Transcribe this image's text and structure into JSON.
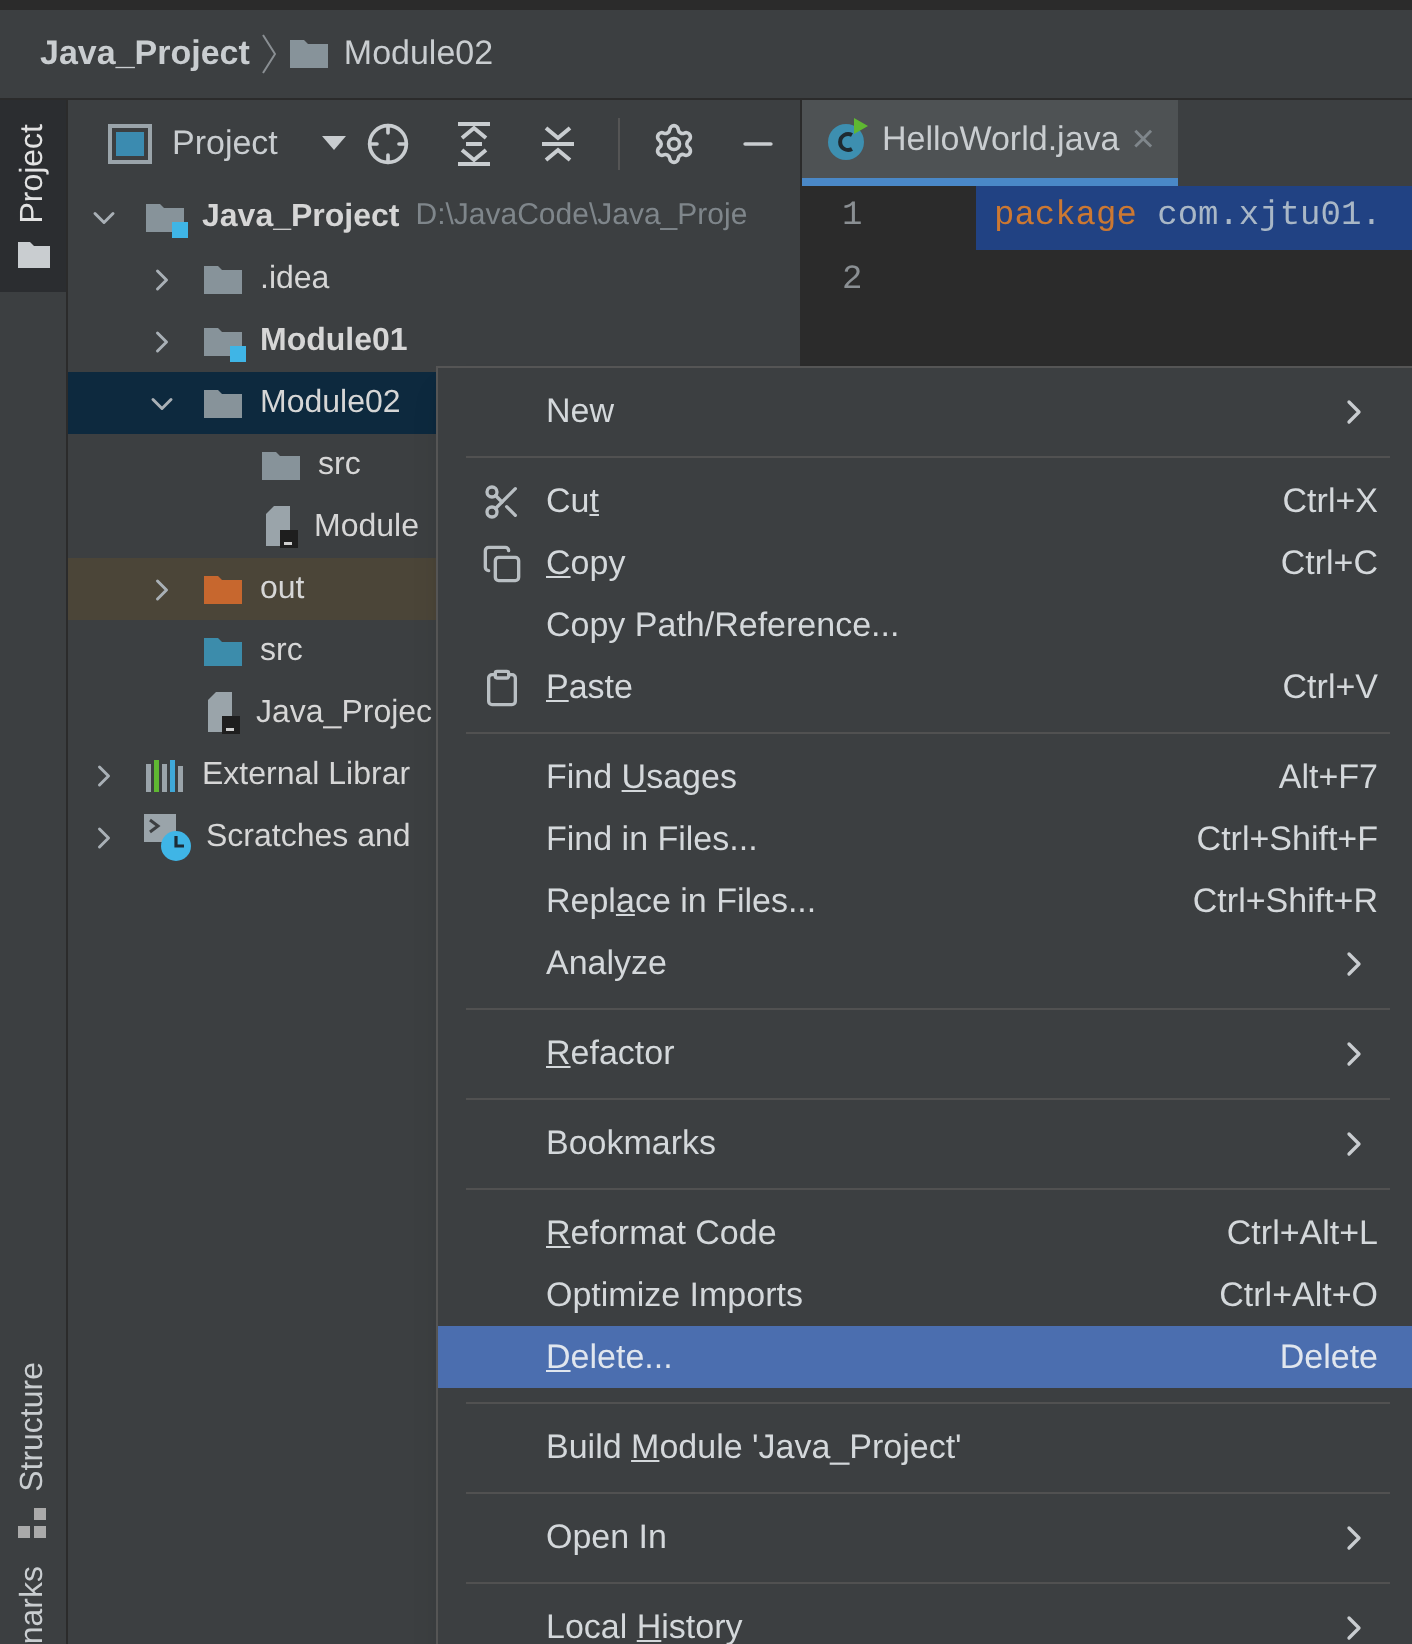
{
  "breadcrumb": [
    {
      "label": "Java_Project",
      "kind": "project"
    },
    {
      "label": "Module02",
      "kind": "folder"
    }
  ],
  "tool_strip": {
    "top": [
      {
        "label": "Project",
        "selected": true
      }
    ],
    "bottom": [
      {
        "label": "Structure",
        "selected": false
      },
      {
        "label": "narks",
        "selected": false
      }
    ]
  },
  "project_panel": {
    "title": "Project"
  },
  "tree": [
    {
      "label": "Java_Project",
      "path": "D:\\JavaCode\\Java_Proje",
      "kind": "module",
      "bold": true,
      "expanded": true,
      "selected": false,
      "highlighted": false,
      "children": [
        {
          "label": ".idea",
          "kind": "folder",
          "bold": false,
          "expanded": false,
          "selected": false,
          "highlighted": false
        },
        {
          "label": "Module01",
          "kind": "module",
          "bold": true,
          "expanded": false,
          "selected": false,
          "highlighted": false
        },
        {
          "label": "Module02",
          "kind": "folder",
          "bold": false,
          "expanded": true,
          "selected": true,
          "children": [
            {
              "label": "src",
              "kind": "folder",
              "bold": false,
              "selected": false,
              "highlighted": false
            },
            {
              "label": "Module",
              "kind": "file",
              "bold": false,
              "selected": false,
              "highlighted": false
            }
          ]
        },
        {
          "label": "out",
          "kind": "excluded",
          "bold": false,
          "expanded": false,
          "selected": false,
          "highlighted": true
        },
        {
          "label": "src",
          "kind": "source",
          "bold": false,
          "selected": false,
          "highlighted": false
        },
        {
          "label": "Java_Projec",
          "kind": "file",
          "bold": false,
          "selected": false,
          "highlighted": false
        }
      ]
    },
    {
      "label": "External Librar",
      "kind": "library",
      "bold": false,
      "expanded": false,
      "selected": false,
      "highlighted": false
    },
    {
      "label": "Scratches and",
      "kind": "scratch",
      "bold": false,
      "expanded": false,
      "selected": false,
      "highlighted": false
    }
  ],
  "editor": {
    "tab": {
      "label": "HelloWorld.java",
      "close": "×",
      "selected": true
    },
    "lines": [
      {
        "number": "1",
        "keyword": "package",
        "code": " com.xjtu01.",
        "selected": true
      },
      {
        "number": "2"
      }
    ]
  },
  "context_menu": [
    {
      "kind": "item",
      "label": [
        {
          "text": "New",
          "underlined": false
        }
      ],
      "submenu": true,
      "selected": false
    },
    {
      "kind": "separator"
    },
    {
      "kind": "item",
      "label": [
        {
          "text": "Cu",
          "underlined": false
        },
        {
          "text": "t",
          "underlined": true
        }
      ],
      "shortcut": "Ctrl+X",
      "submenu": false,
      "selected": false
    },
    {
      "kind": "item",
      "label": [
        {
          "text": "C",
          "underlined": true
        },
        {
          "text": "opy",
          "underlined": false
        }
      ],
      "shortcut": "Ctrl+C",
      "submenu": false,
      "selected": false
    },
    {
      "kind": "item",
      "label": [
        {
          "text": "Copy Path/Reference...",
          "underlined": false
        }
      ],
      "submenu": false,
      "selected": false
    },
    {
      "kind": "item",
      "label": [
        {
          "text": "P",
          "underlined": true
        },
        {
          "text": "aste",
          "underlined": false
        }
      ],
      "shortcut": "Ctrl+V",
      "submenu": false,
      "selected": false
    },
    {
      "kind": "separator"
    },
    {
      "kind": "item",
      "label": [
        {
          "text": "Find ",
          "underlined": false
        },
        {
          "text": "U",
          "underlined": true
        },
        {
          "text": "sages",
          "underlined": false
        }
      ],
      "shortcut": "Alt+F7",
      "submenu": false,
      "selected": false
    },
    {
      "kind": "item",
      "label": [
        {
          "text": "Find in Files...",
          "underlined": false
        }
      ],
      "shortcut": "Ctrl+Shift+F",
      "submenu": false,
      "selected": false
    },
    {
      "kind": "item",
      "label": [
        {
          "text": "Repl",
          "underlined": false
        },
        {
          "text": "a",
          "underlined": true
        },
        {
          "text": "ce in Files...",
          "underlined": false
        }
      ],
      "shortcut": "Ctrl+Shift+R",
      "submenu": false,
      "selected": false
    },
    {
      "kind": "item",
      "label": [
        {
          "text": "Analyze",
          "underlined": false
        }
      ],
      "submenu": true,
      "selected": false
    },
    {
      "kind": "separator"
    },
    {
      "kind": "item",
      "label": [
        {
          "text": "R",
          "underlined": true
        },
        {
          "text": "efactor",
          "underlined": false
        }
      ],
      "submenu": true,
      "selected": false
    },
    {
      "kind": "separator"
    },
    {
      "kind": "item",
      "label": [
        {
          "text": "Bookmarks",
          "underlined": false
        }
      ],
      "submenu": true,
      "selected": false
    },
    {
      "kind": "separator"
    },
    {
      "kind": "item",
      "label": [
        {
          "text": "R",
          "underlined": true
        },
        {
          "text": "eformat Code",
          "underlined": false
        }
      ],
      "shortcut": "Ctrl+Alt+L",
      "submenu": false,
      "selected": false
    },
    {
      "kind": "item",
      "label": [
        {
          "text": "Optimize Imports",
          "underlined": false
        }
      ],
      "shortcut": "Ctrl+Alt+O",
      "submenu": false,
      "selected": false
    },
    {
      "kind": "item",
      "label": [
        {
          "text": "D",
          "underlined": true
        },
        {
          "text": "elete...",
          "underlined": false
        }
      ],
      "shortcut": "Delete",
      "submenu": false,
      "selected": true
    },
    {
      "kind": "separator"
    },
    {
      "kind": "item",
      "label": [
        {
          "text": "Build ",
          "underlined": false
        },
        {
          "text": "M",
          "underlined": true
        },
        {
          "text": "odule 'Java_Project'",
          "underlined": false
        }
      ],
      "submenu": false,
      "selected": false
    },
    {
      "kind": "separator"
    },
    {
      "kind": "item",
      "label": [
        {
          "text": "Open In",
          "underlined": false
        }
      ],
      "submenu": true,
      "selected": false
    },
    {
      "kind": "separator"
    },
    {
      "kind": "item",
      "label": [
        {
          "text": "Local ",
          "underlined": false
        },
        {
          "text": "H",
          "underlined": true
        },
        {
          "text": "istory",
          "underlined": false
        }
      ],
      "submenu": true,
      "selected": false
    }
  ]
}
